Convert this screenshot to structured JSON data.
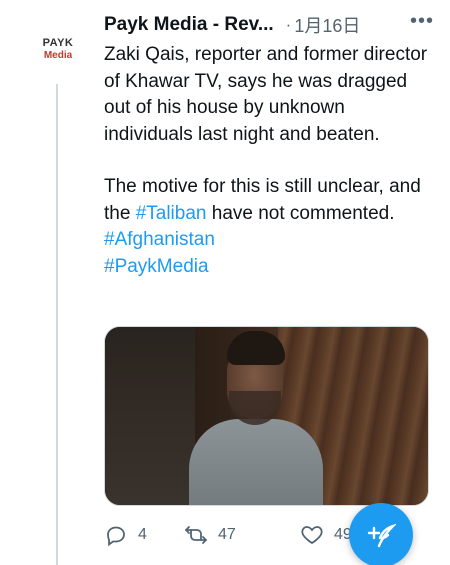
{
  "tweet": {
    "avatar": {
      "line1": "PAYK",
      "line2": "Media"
    },
    "author": "Payk Media - Rev...",
    "separator": "·",
    "date": "1月16日",
    "more": "•••",
    "text": {
      "p1": "Zaki Qais, reporter and former director of Khawar TV, says he was dragged out of his house by unknown individuals last night and beaten.",
      "p2_before": "The motive for this is still unclear, and the ",
      "hashtag1": "#Taliban",
      "p2_middle": " have not commented. ",
      "hashtag2": "#Afghanistan",
      "hashtag3": "#PaykMedia"
    },
    "media": {
      "alt": "photo",
      "icon": "photo"
    },
    "actions": {
      "reply_count": "4",
      "retweet_count": "47",
      "like_count": "49",
      "reply_icon": "reply-icon",
      "retweet_icon": "retweet-icon",
      "like_icon": "heart-icon",
      "share_icon": "share-icon"
    },
    "fab": {
      "icon": "compose-icon"
    }
  },
  "colors": {
    "accent": "#1d9bf0",
    "text": "#0f1419",
    "muted": "#536471",
    "line": "#cfd9de"
  }
}
